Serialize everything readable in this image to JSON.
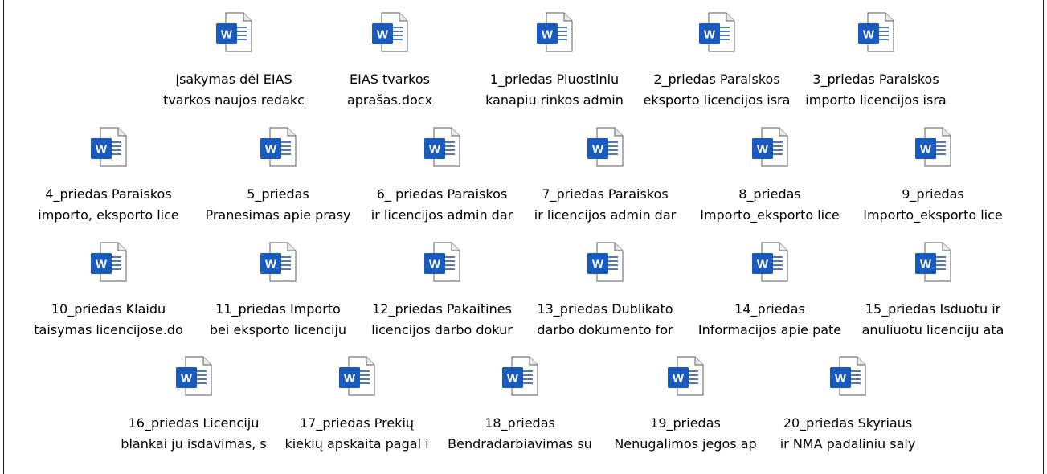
{
  "icon": "word-document-icon",
  "colors": {
    "word_blue": "#2b579a",
    "word_dark": "#185abd",
    "page_border": "#777777"
  },
  "files": [
    {
      "line1": "Įsakymas dėl EIAS",
      "line2": "tvarkos naujos redakc"
    },
    {
      "line1": "EIAS tvarkos",
      "line2": "aprašas.docx"
    },
    {
      "line1": "1_priedas Pluostiniu",
      "line2": "kanapiu rinkos admin"
    },
    {
      "line1": "2_priedas Paraiskos",
      "line2": "eksporto licencijos isra"
    },
    {
      "line1": "3_priedas Paraiskos",
      "line2": "importo licencijos isra"
    },
    {
      "line1": "4_priedas Paraiskos",
      "line2": "importo, eksporto lice"
    },
    {
      "line1": "5_priedas",
      "line2": "Pranesimas apie prasy"
    },
    {
      "line1": "6_ priedas Paraiskos",
      "line2": "ir licencijos admin dar"
    },
    {
      "line1": "7_priedas Paraiskos",
      "line2": "ir licencijos admin dar"
    },
    {
      "line1": "8_priedas",
      "line2": "Importo_eksporto lice"
    },
    {
      "line1": "9_priedas",
      "line2": "Importo_eksporto lice"
    },
    {
      "line1": "10_priedas Klaidu",
      "line2": "taisymas licencijose.do"
    },
    {
      "line1": "11_priedas  Importo",
      "line2": "bei eksporto licenciju"
    },
    {
      "line1": "12_priedas Pakaitines",
      "line2": "licencijos darbo dokur"
    },
    {
      "line1": "13_priedas Dublikato",
      "line2": "darbo dokumento for"
    },
    {
      "line1": "14_priedas",
      "line2": "Informacijos apie pate"
    },
    {
      "line1": "15_priedas Isduotu ir",
      "line2": "anuliuotu licenciju ata"
    },
    {
      "line1": "16_priedas Licenciju",
      "line2": "blankai ju isdavimas, s"
    },
    {
      "line1": "17_priedas Prekių",
      "line2": "kiekių apskaita pagal i"
    },
    {
      "line1": "18_priedas",
      "line2": "Bendradarbiavimas su"
    },
    {
      "line1": "19_priedas",
      "line2": "Nenugalimos jegos ap"
    },
    {
      "line1": "20_priedas Skyriaus",
      "line2": "ir NMA padaliniu saly"
    }
  ]
}
